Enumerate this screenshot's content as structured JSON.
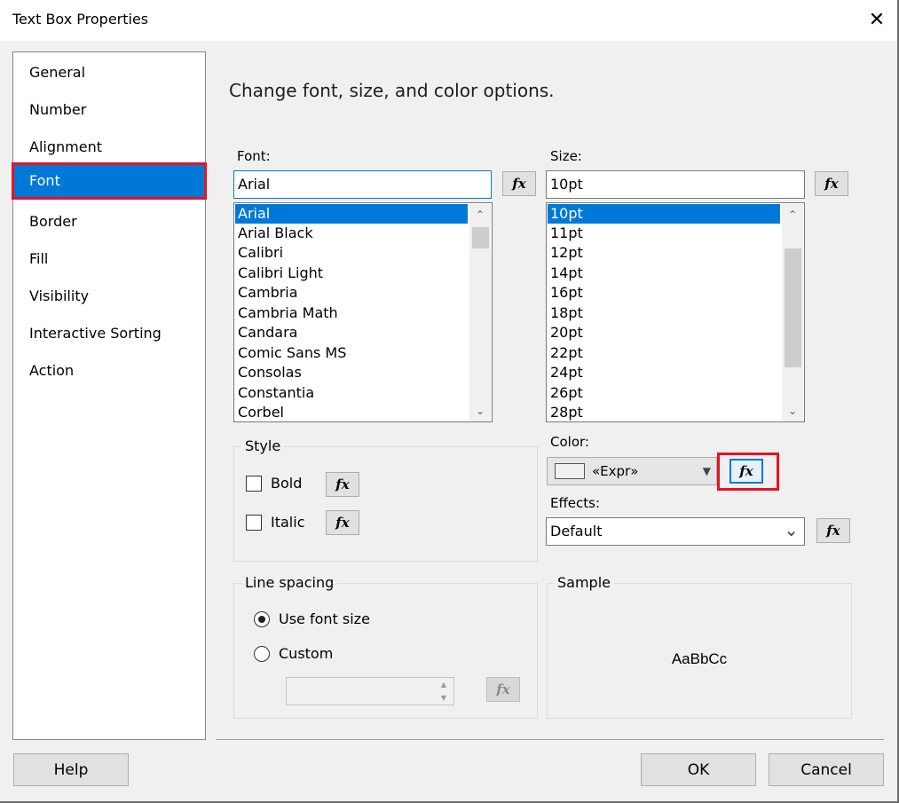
{
  "window": {
    "title": "Text Box Properties",
    "close_glyph": "✕"
  },
  "nav": {
    "items": [
      {
        "label": "General"
      },
      {
        "label": "Number"
      },
      {
        "label": "Alignment"
      },
      {
        "label": "Font"
      },
      {
        "label": "Border"
      },
      {
        "label": "Fill"
      },
      {
        "label": "Visibility"
      },
      {
        "label": "Interactive Sorting"
      },
      {
        "label": "Action"
      }
    ],
    "selected": "Font"
  },
  "header": {
    "text": "Change font, size, and color options."
  },
  "font": {
    "label": "Font:",
    "value": "Arial",
    "fx": "fx",
    "options": [
      "Arial",
      "Arial Black",
      "Calibri",
      "Calibri Light",
      "Cambria",
      "Cambria Math",
      "Candara",
      "Comic Sans MS",
      "Consolas",
      "Constantia",
      "Corbel"
    ],
    "selected": "Arial"
  },
  "size": {
    "label": "Size:",
    "value": "10pt",
    "fx": "fx",
    "options": [
      "10pt",
      "11pt",
      "12pt",
      "14pt",
      "16pt",
      "18pt",
      "20pt",
      "22pt",
      "24pt",
      "26pt",
      "28pt"
    ],
    "selected": "10pt"
  },
  "scroll": {
    "up": "⌃",
    "down": "⌄"
  },
  "style": {
    "title": "Style",
    "bold": {
      "label": "Bold",
      "checked": false
    },
    "italic": {
      "label": "Italic",
      "checked": false
    },
    "fx": "fx"
  },
  "color": {
    "label": "Color:",
    "value": "«Expr»",
    "swatch": "#f0f0f0",
    "fx": "fx",
    "dropdown_glyph": "▼"
  },
  "effects": {
    "label": "Effects:",
    "value": "Default",
    "fx": "fx",
    "dropdown_glyph": "⌄"
  },
  "line_spacing": {
    "title": "Line spacing",
    "use_font_size": {
      "label": "Use font size",
      "checked": true
    },
    "custom": {
      "label": "Custom",
      "checked": false
    },
    "custom_value": "",
    "fx": "fx",
    "spin_up": "▲",
    "spin_down": "▼"
  },
  "sample": {
    "title": "Sample",
    "text": "AaBbCc"
  },
  "buttons": {
    "help": "Help",
    "ok": "OK",
    "cancel": "Cancel"
  },
  "colors": {
    "accent": "#0078d7",
    "highlight": "#e81123"
  }
}
